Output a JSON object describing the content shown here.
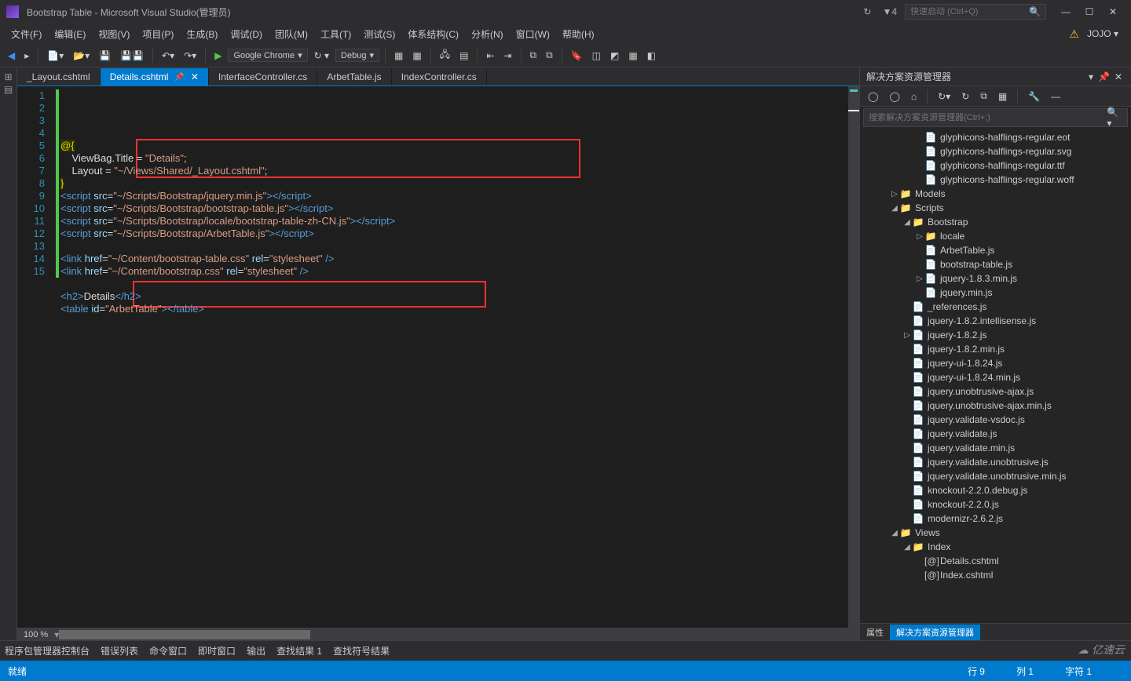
{
  "titleBar": {
    "title": "Bootstrap Table - Microsoft Visual Studio(管理员)",
    "notifRetry": "↻",
    "notifFilter": "▼4",
    "searchPlaceholder": "快速启动 (Ctrl+Q)"
  },
  "menu": {
    "items": [
      "文件(F)",
      "编辑(E)",
      "视图(V)",
      "项目(P)",
      "生成(B)",
      "调试(D)",
      "团队(M)",
      "工具(T)",
      "测试(S)",
      "体系结构(C)",
      "分析(N)",
      "窗口(W)",
      "帮助(H)"
    ],
    "user": "JOJO ▾"
  },
  "toolbar": {
    "browser": "Google Chrome",
    "config": "Debug"
  },
  "fileTabs": [
    {
      "label": "_Layout.cshtml",
      "active": false
    },
    {
      "label": "Details.cshtml",
      "active": true,
      "pinned": true,
      "close": true
    },
    {
      "label": "InterfaceController.cs",
      "active": false
    },
    {
      "label": "ArbetTable.js",
      "active": false
    },
    {
      "label": "IndexController.cs",
      "active": false
    }
  ],
  "codeLines": [
    {
      "n": 1,
      "html": "<span class='razor'>@{</span>"
    },
    {
      "n": 2,
      "html": "    ViewBag.Title = <span class='str'>\"Details\"</span>;"
    },
    {
      "n": 3,
      "html": "    Layout = <span class='str'>\"~/Views/Shared/_Layout.cshtml\"</span>;"
    },
    {
      "n": 4,
      "html": "<span class='razor'>}</span>"
    },
    {
      "n": 5,
      "html": "<span class='tag'>&lt;script</span> <span class='attr'>src</span>=<span class='str'>\"~/Scripts/Bootstrap/jquery.min.js\"</span><span class='tag'>&gt;&lt;/script&gt;</span>"
    },
    {
      "n": 6,
      "html": "<span class='tag'>&lt;script</span> <span class='attr'>src</span>=<span class='str'>\"~/Scripts/Bootstrap/bootstrap-table.js\"</span><span class='tag'>&gt;&lt;/script&gt;</span>"
    },
    {
      "n": 7,
      "html": "<span class='tag'>&lt;script</span> <span class='attr'>src</span>=<span class='str'>\"~/Scripts/Bootstrap/locale/bootstrap-table-zh-CN.js\"</span><span class='tag'>&gt;&lt;/script&gt;</span>"
    },
    {
      "n": 8,
      "html": "<span class='tag'>&lt;script</span> <span class='attr'>src</span>=<span class='str'>\"~/Scripts/Bootstrap/ArbetTable.js\"</span><span class='tag'>&gt;&lt;/script&gt;</span>"
    },
    {
      "n": 9,
      "html": ""
    },
    {
      "n": 10,
      "html": "<span class='tag'>&lt;link</span> <span class='attr'>href</span>=<span class='str'>\"~/Content/bootstrap-table.css\"</span> <span class='attr'>rel</span>=<span class='str'>\"stylesheet\"</span> <span class='tag'>/&gt;</span>"
    },
    {
      "n": 11,
      "html": "<span class='tag'>&lt;link</span> <span class='attr'>href</span>=<span class='str'>\"~/Content/bootstrap.css\"</span> <span class='attr'>rel</span>=<span class='str'>\"stylesheet\"</span> <span class='tag'>/&gt;</span>"
    },
    {
      "n": 12,
      "html": ""
    },
    {
      "n": 13,
      "html": "<span class='tag'>&lt;h2&gt;</span>Details<span class='tag'>&lt;/h2&gt;</span>"
    },
    {
      "n": 14,
      "html": "<span class='tag'>&lt;table</span> <span class='attr'>id</span>=<span class='str'>\"ArbetTable\"</span><span class='tag'>&gt;&lt;/table&gt;</span>"
    },
    {
      "n": 15,
      "html": ""
    }
  ],
  "zoom": "100 %",
  "solution": {
    "title": "解决方案资源管理器",
    "searchPlaceholder": "搜索解决方案资源管理器(Ctrl+;)",
    "tree": [
      {
        "depth": 4,
        "icon": "file",
        "label": "glyphicons-halflings-regular.eot"
      },
      {
        "depth": 4,
        "icon": "file",
        "label": "glyphicons-halflings-regular.svg"
      },
      {
        "depth": 4,
        "icon": "file",
        "label": "glyphicons-halflings-regular.ttf"
      },
      {
        "depth": 4,
        "icon": "file",
        "label": "glyphicons-halflings-regular.woff"
      },
      {
        "depth": 2,
        "icon": "folder",
        "label": "Models",
        "chv": "▷"
      },
      {
        "depth": 2,
        "icon": "folder",
        "label": "Scripts",
        "chv": "◢"
      },
      {
        "depth": 3,
        "icon": "folder",
        "label": "Bootstrap",
        "chv": "◢"
      },
      {
        "depth": 4,
        "icon": "folder",
        "label": "locale",
        "chv": "▷"
      },
      {
        "depth": 4,
        "icon": "js",
        "label": "ArbetTable.js"
      },
      {
        "depth": 4,
        "icon": "js",
        "label": "bootstrap-table.js"
      },
      {
        "depth": 4,
        "icon": "js",
        "label": "jquery-1.8.3.min.js",
        "chv": "▷"
      },
      {
        "depth": 4,
        "icon": "js",
        "label": "jquery.min.js"
      },
      {
        "depth": 3,
        "icon": "js",
        "label": "_references.js"
      },
      {
        "depth": 3,
        "icon": "js",
        "label": "jquery-1.8.2.intellisense.js"
      },
      {
        "depth": 3,
        "icon": "js",
        "label": "jquery-1.8.2.js",
        "chv": "▷"
      },
      {
        "depth": 3,
        "icon": "js",
        "label": "jquery-1.8.2.min.js"
      },
      {
        "depth": 3,
        "icon": "js",
        "label": "jquery-ui-1.8.24.js"
      },
      {
        "depth": 3,
        "icon": "js",
        "label": "jquery-ui-1.8.24.min.js"
      },
      {
        "depth": 3,
        "icon": "js",
        "label": "jquery.unobtrusive-ajax.js"
      },
      {
        "depth": 3,
        "icon": "js",
        "label": "jquery.unobtrusive-ajax.min.js"
      },
      {
        "depth": 3,
        "icon": "js",
        "label": "jquery.validate-vsdoc.js"
      },
      {
        "depth": 3,
        "icon": "js",
        "label": "jquery.validate.js"
      },
      {
        "depth": 3,
        "icon": "js",
        "label": "jquery.validate.min.js"
      },
      {
        "depth": 3,
        "icon": "js",
        "label": "jquery.validate.unobtrusive.js"
      },
      {
        "depth": 3,
        "icon": "js",
        "label": "jquery.validate.unobtrusive.min.js"
      },
      {
        "depth": 3,
        "icon": "js",
        "label": "knockout-2.2.0.debug.js"
      },
      {
        "depth": 3,
        "icon": "js",
        "label": "knockout-2.2.0.js"
      },
      {
        "depth": 3,
        "icon": "js",
        "label": "modernizr-2.6.2.js"
      },
      {
        "depth": 2,
        "icon": "folder",
        "label": "Views",
        "chv": "◢"
      },
      {
        "depth": 3,
        "icon": "folder",
        "label": "Index",
        "chv": "◢"
      },
      {
        "depth": 4,
        "icon": "cshtml",
        "label": "Details.cshtml"
      },
      {
        "depth": 4,
        "icon": "cshtml",
        "label": "Index.cshtml"
      }
    ],
    "bottomTabs": [
      {
        "label": "属性",
        "active": false
      },
      {
        "label": "解决方案资源管理器",
        "active": true
      }
    ]
  },
  "bottomTabs": [
    "程序包管理器控制台",
    "错误列表",
    "命令窗口",
    "即时窗口",
    "输出",
    "查找结果 1",
    "查找符号结果"
  ],
  "status": {
    "ready": "就绪",
    "line": "行 9",
    "col": "列 1",
    "char": "字符 1"
  },
  "watermark": "亿速云"
}
